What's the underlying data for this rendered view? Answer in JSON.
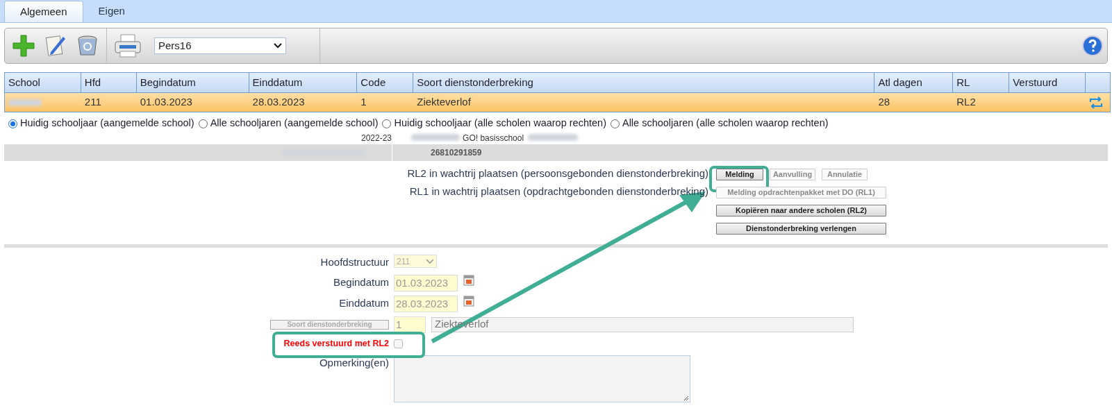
{
  "tabs": [
    {
      "label": "Algemeen",
      "selected": true
    },
    {
      "label": "Eigen",
      "selected": false
    }
  ],
  "toolbar": {
    "printer_select": "Pers16"
  },
  "table": {
    "columns": [
      "School",
      "Hfd",
      "Begindatum",
      "Einddatum",
      "Code",
      "Soort dienstonderbreking",
      "Atl dagen",
      "RL",
      "Verstuurd"
    ],
    "rows": [
      {
        "selected": true,
        "cells": [
          "",
          "211",
          "01.03.2023",
          "28.03.2023",
          "1",
          "Ziekteverlof",
          "28",
          "RL2",
          ""
        ]
      }
    ]
  },
  "scope_options": [
    {
      "label": "Huidig schooljaar (aangemelde school)",
      "selected": true
    },
    {
      "label": "Alle schooljaren (aangemelde school)",
      "selected": false
    },
    {
      "label": "Huidig schooljaar (alle scholen waarop rechten)",
      "selected": false
    },
    {
      "label": "Alle schooljaren (alle scholen waarop rechten)",
      "selected": false
    }
  ],
  "info": {
    "school_year": "2022-23",
    "school_name": "GO! basisschool",
    "number": "26810291859"
  },
  "queue_actions": [
    {
      "label": "RL2 in wachtrij plaatsen (persoonsgebonden dienstonderbreking)",
      "buttons": [
        {
          "label": "Melding",
          "disabled": false
        },
        {
          "label": "Aanvulling",
          "disabled": true
        },
        {
          "label": "Annulatie",
          "disabled": true
        }
      ]
    },
    {
      "label": "RL1 in wachtrij plaatsen (opdrachtgebonden dienstonderbreking)",
      "buttons": [
        {
          "label": "Melding opdrachtenpakket met DO (RL1)",
          "disabled": true
        }
      ]
    }
  ],
  "extra_buttons": [
    {
      "label": "Kopiëren naar andere scholen (RL2)",
      "disabled": false
    },
    {
      "label": "Dienstonderbreking verlengen",
      "disabled": false
    }
  ],
  "form": {
    "hoofdstructuur": {
      "label": "Hoofdstructuur",
      "value": "211"
    },
    "begindatum": {
      "label": "Begindatum",
      "value": "01.03.2023"
    },
    "einddatum": {
      "label": "Einddatum",
      "value": "28.03.2023"
    },
    "soort": {
      "button": "Soort dienstonderbreking",
      "code": "1",
      "value": "Ziekteverlof"
    },
    "reeds": {
      "label": "Reeds verstuurd met RL2",
      "checked": false
    },
    "opmerking": {
      "label": "Opmerking(en)"
    }
  }
}
